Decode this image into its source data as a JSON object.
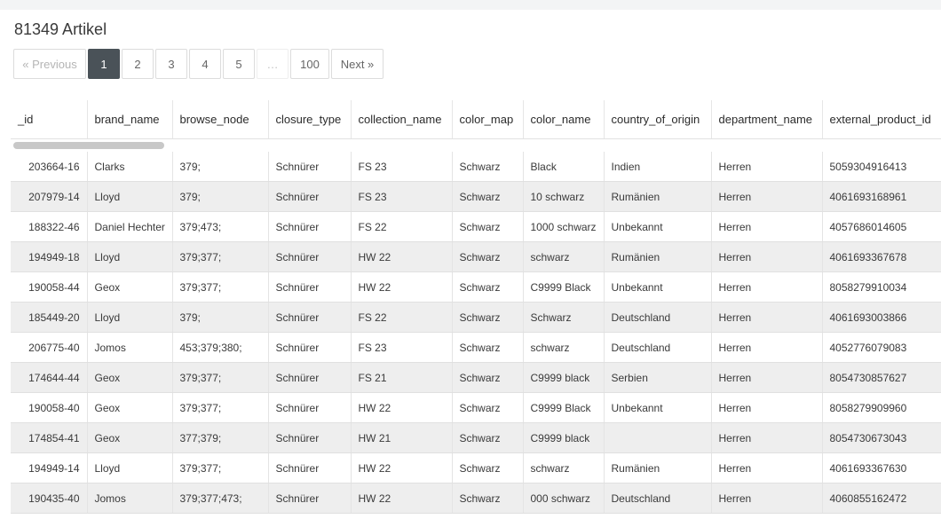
{
  "header": {
    "title": "81349 Artikel"
  },
  "pagination": {
    "previous": "« Previous",
    "pages": [
      "1",
      "2",
      "3",
      "4",
      "5"
    ],
    "ellipsis": "…",
    "last": "100",
    "next": "Next »",
    "active": "1"
  },
  "table": {
    "columns": [
      "_id",
      "brand_name",
      "browse_node",
      "closure_type",
      "collection_name",
      "color_map",
      "color_name",
      "country_of_origin",
      "department_name",
      "external_product_id"
    ],
    "rows": [
      [
        "203664-16",
        "Clarks",
        "379;",
        "Schnürer",
        "FS 23",
        "Schwarz",
        "Black",
        "Indien",
        "Herren",
        "5059304916413"
      ],
      [
        "207979-14",
        "Lloyd",
        "379;",
        "Schnürer",
        "FS 23",
        "Schwarz",
        "10 schwarz",
        "Rumänien",
        "Herren",
        "4061693168961"
      ],
      [
        "188322-46",
        "Daniel Hechter",
        "379;473;",
        "Schnürer",
        "FS 22",
        "Schwarz",
        "1000 schwarz",
        "Unbekannt",
        "Herren",
        "4057686014605"
      ],
      [
        "194949-18",
        "Lloyd",
        "379;377;",
        "Schnürer",
        "HW 22",
        "Schwarz",
        "schwarz",
        "Rumänien",
        "Herren",
        "4061693367678"
      ],
      [
        "190058-44",
        "Geox",
        "379;377;",
        "Schnürer",
        "HW 22",
        "Schwarz",
        "C9999 Black",
        "Unbekannt",
        "Herren",
        "8058279910034"
      ],
      [
        "185449-20",
        "Lloyd",
        "379;",
        "Schnürer",
        "FS 22",
        "Schwarz",
        "Schwarz",
        "Deutschland",
        "Herren",
        "4061693003866"
      ],
      [
        "206775-40",
        "Jomos",
        "453;379;380;",
        "Schnürer",
        "FS 23",
        "Schwarz",
        "schwarz",
        "Deutschland",
        "Herren",
        "4052776079083"
      ],
      [
        "174644-44",
        "Geox",
        "379;377;",
        "Schnürer",
        "FS 21",
        "Schwarz",
        "C9999 black",
        "Serbien",
        "Herren",
        "8054730857627"
      ],
      [
        "190058-40",
        "Geox",
        "379;377;",
        "Schnürer",
        "HW 22",
        "Schwarz",
        "C9999 Black",
        "Unbekannt",
        "Herren",
        "8058279909960"
      ],
      [
        "174854-41",
        "Geox",
        "377;379;",
        "Schnürer",
        "HW 21",
        "Schwarz",
        "C9999 black",
        "",
        "Herren",
        "8054730673043"
      ],
      [
        "194949-14",
        "Lloyd",
        "379;377;",
        "Schnürer",
        "HW 22",
        "Schwarz",
        "schwarz",
        "Rumänien",
        "Herren",
        "4061693367630"
      ],
      [
        "190435-40",
        "Jomos",
        "379;377;473;",
        "Schnürer",
        "HW 22",
        "Schwarz",
        "000 schwarz",
        "Deutschland",
        "Herren",
        "4060855162472"
      ]
    ]
  }
}
